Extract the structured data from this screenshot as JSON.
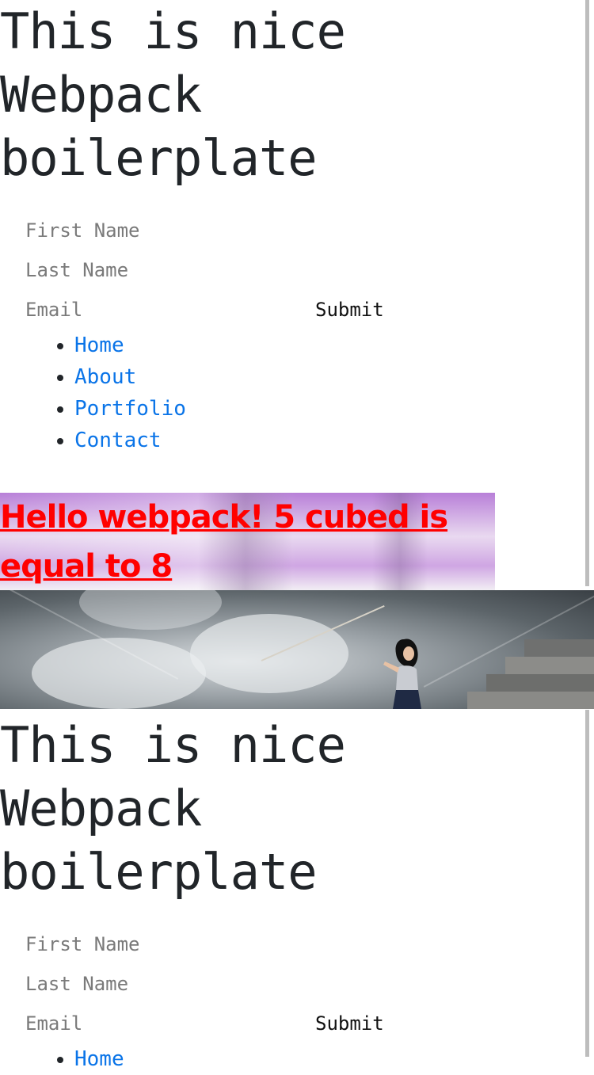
{
  "sections": [
    {
      "title": "This is nice Webpack boilerplate",
      "form": {
        "first_name_placeholder": "First Name",
        "last_name_placeholder": "Last Name",
        "email_placeholder": "Email",
        "submit_label": "Submit"
      },
      "nav": [
        "Home",
        "About",
        "Portfolio",
        "Contact"
      ]
    }
  ],
  "hello": {
    "text": "Hello webpack! 5 cubed is equal to 8"
  },
  "photo": {
    "description_icon": "woman-pulling-rope-icon"
  },
  "repeat": {
    "title": "This is nice Webpack boilerplate",
    "form": {
      "first_name_placeholder": "First Name",
      "last_name_placeholder": "Last Name",
      "email_placeholder": "Email",
      "submit_label": "Submit"
    },
    "nav": [
      "Home"
    ]
  },
  "colors": {
    "link": "#0a74e8",
    "hello_text": "#ff0000",
    "title_text": "#212529",
    "placeholder": "#7a7a7a"
  }
}
